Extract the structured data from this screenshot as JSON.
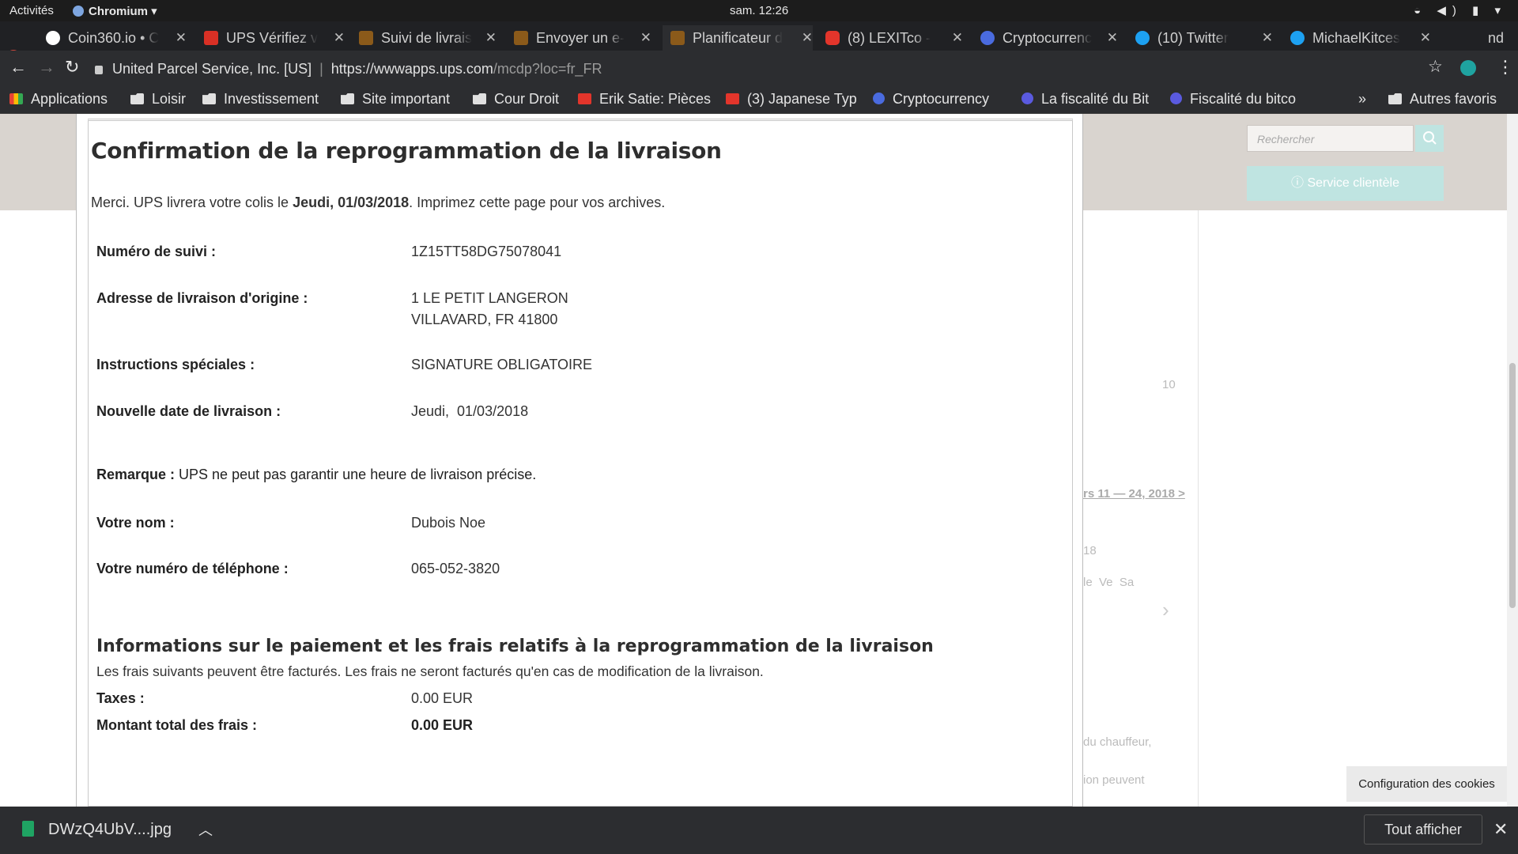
{
  "system": {
    "activities": "Activités",
    "app": "Chromium",
    "clock": "sam. 12:26"
  },
  "tabs": [
    {
      "title": "Coin360.io • C",
      "color": "#ffffff"
    },
    {
      "title": "UPS Vérifiez v",
      "color": "#d93025"
    },
    {
      "title": "Suivi de livrais",
      "color": "#8b5a1a"
    },
    {
      "title": "Envoyer un e-",
      "color": "#8b5a1a"
    },
    {
      "title": "Planificateur d",
      "color": "#8b5a1a"
    },
    {
      "title": "(8) LEXITco - ",
      "color": "#e3352b"
    },
    {
      "title": "Cryptocurrenc",
      "color": "#4a6bdf"
    },
    {
      "title": "(10) Twitter",
      "color": "#1da1f2"
    },
    {
      "title": "MichaelKitces",
      "color": "#1da1f2"
    }
  ],
  "tab_overflow": "nd",
  "url": {
    "site": "United Parcel Service, Inc. [US]",
    "host": "https://wwwapps.ups.com",
    "path": "/mcdp?loc=fr_FR"
  },
  "bookmarks": {
    "apps": "Applications",
    "items": [
      "Loisir",
      "Investissement",
      "Site important",
      "Cour Droit",
      "Erik Satie: Pièces",
      "(3) Japanese Typ",
      "Cryptocurrency ",
      "La fiscalité du Bit",
      "Fiscalité du bitco"
    ],
    "more": "»",
    "other": "Autres favoris"
  },
  "header": {
    "search_placeholder": "Rechercher",
    "service": "Service clientèle"
  },
  "background": {
    "num": "10",
    "range": "rs 11 — 24, 2018 >",
    "yr": "18",
    "days": "le  Ve  Sa",
    "note1": "du chauffeur,",
    "note2": "ion peuvent"
  },
  "confirm": {
    "title": "Confirmation de la reprogrammation de la livraison",
    "intro_pre": "Merci. UPS livrera votre colis le ",
    "intro_bold": "Jeudi, 01/03/2018",
    "intro_post": ". Imprimez cette page pour vos archives.",
    "tracking_label": "Numéro de suivi :",
    "tracking_value": "1Z15TT58DG75078041",
    "address_label": "Adresse de livraison d'origine :",
    "address_line1": "1 LE PETIT LANGERON",
    "address_line2": "VILLAVARD, FR 41800",
    "instructions_label": "Instructions spéciales :",
    "instructions_value": "SIGNATURE OBLIGATOIRE",
    "newdate_label": "Nouvelle date de livraison :",
    "newdate_value": "Jeudi,  01/03/2018",
    "remark_label": "Remarque :",
    "remark_text": " UPS ne peut pas garantir une heure de livraison précise.",
    "name_label": "Votre nom :",
    "name_value": "Dubois Noe",
    "phone_label": "Votre numéro de téléphone :",
    "phone_value": "065-052-3820",
    "fees_title": "Informations sur le paiement et les frais relatifs à la reprogrammation de la livraison",
    "fees_note": "Les frais suivants peuvent être facturés. Les frais ne seront facturés qu'en cas de modification de la livraison.",
    "taxes_label": "Taxes :",
    "taxes_value": "0.00 EUR",
    "total_label": "Montant total des frais :",
    "total_value": "0.00 EUR"
  },
  "cookie_button": "Configuration des cookies",
  "download": {
    "file": "DWzQ4UbV....jpg",
    "show_all": "Tout afficher",
    "close": "✕"
  }
}
